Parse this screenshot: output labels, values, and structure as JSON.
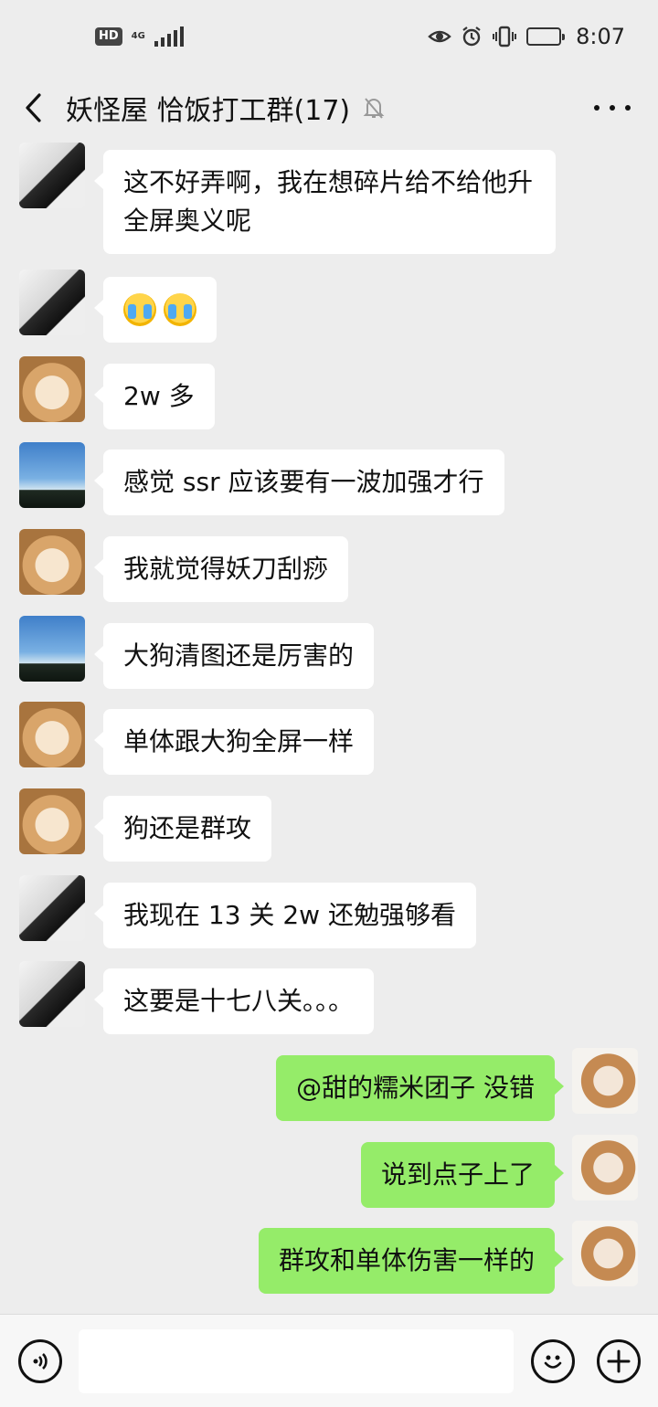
{
  "status_bar": {
    "hd": "HD",
    "network": "4G",
    "time": "8:07",
    "battery_level": 0.45
  },
  "header": {
    "title": "妖怪屋 恰饭打工群(17)"
  },
  "messages": [
    {
      "side": "left",
      "avatar": "avatar-man",
      "text": "这不好弄啊，我在想碎片给不给他升全屏奥义呢"
    },
    {
      "side": "left",
      "avatar": "avatar-man",
      "emoji": [
        "crying-emoji",
        "crying-emoji"
      ]
    },
    {
      "side": "left",
      "avatar": "avatar-bear",
      "text": "2w 多"
    },
    {
      "side": "left",
      "avatar": "avatar-sky",
      "text": "感觉 ssr 应该要有一波加强才行"
    },
    {
      "side": "left",
      "avatar": "avatar-bear",
      "text": "我就觉得妖刀刮痧"
    },
    {
      "side": "left",
      "avatar": "avatar-sky",
      "text": "大狗清图还是厉害的"
    },
    {
      "side": "left",
      "avatar": "avatar-bear",
      "text": "单体跟大狗全屏一样"
    },
    {
      "side": "left",
      "avatar": "avatar-bear",
      "text": "狗还是群攻"
    },
    {
      "side": "left",
      "avatar": "avatar-man",
      "text": "我现在 13 关 2w 还勉强够看"
    },
    {
      "side": "left",
      "avatar": "avatar-man",
      "text": "这要是十七八关。。。"
    },
    {
      "side": "right",
      "avatar": "avatar-dog",
      "text": "@甜的糯米团子  没错"
    },
    {
      "side": "right",
      "avatar": "avatar-dog",
      "text": "说到点子上了"
    },
    {
      "side": "right",
      "avatar": "avatar-dog",
      "text": "群攻和单体伤害一样的"
    }
  ],
  "input_bar": {
    "value": "",
    "icons": [
      "voice-icon",
      "emoji-icon",
      "add-icon"
    ]
  },
  "colors": {
    "background": "#ededed",
    "incoming_bubble": "#ffffff",
    "outgoing_bubble": "#95ec69"
  }
}
